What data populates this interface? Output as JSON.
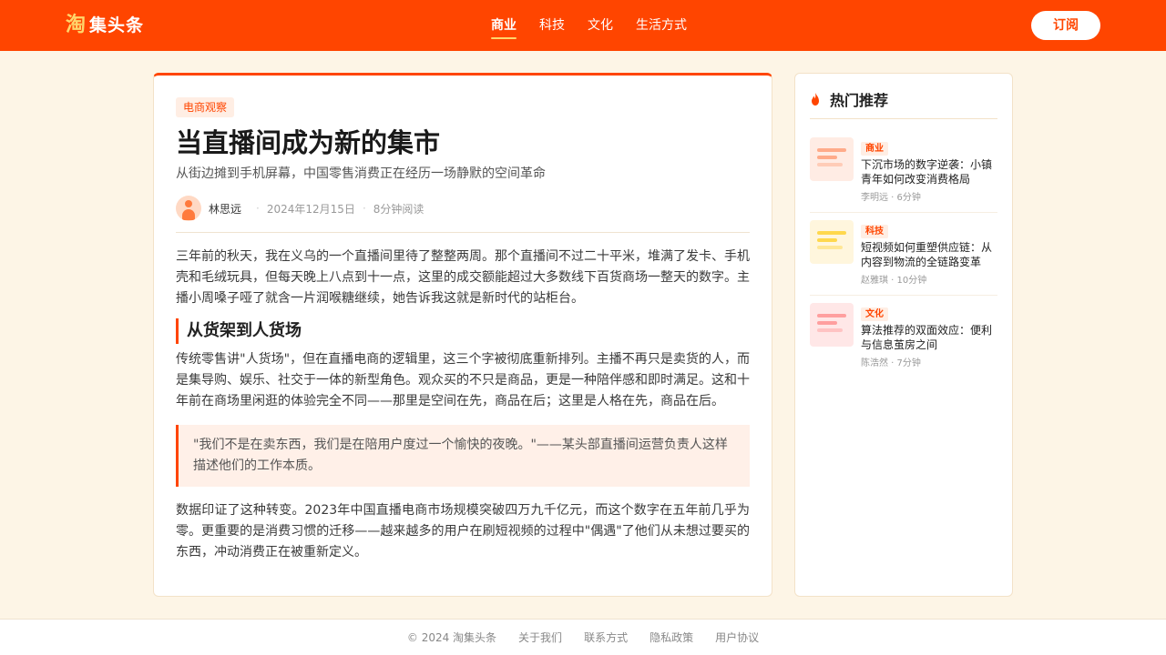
{
  "header": {
    "logo_mark": "淘",
    "logo_text": "集头条",
    "nav": [
      "商业",
      "科技",
      "文化",
      "生活方式"
    ],
    "subscribe_label": "订阅"
  },
  "article": {
    "category": "电商观察",
    "title": "当直播间成为新的集市",
    "subtitle": "从街边摊到手机屏幕，中国零售消费正在经历一场静默的空间革命",
    "author": "林思远",
    "date": "2024年12月15日",
    "read_time": "8分钟阅读",
    "paragraph1": "三年前的秋天，我在义乌的一个直播间里待了整整两周。那个直播间不过二十平米，堆满了发卡、手机壳和毛绒玩具，但每天晚上八点到十一点，这里的成交额能超过大多数线下百货商场一整天的数字。主播小周嗓子哑了就含一片润喉糖继续，她告诉我这就是新时代的站柜台。",
    "section_heading": "从货架到人货场",
    "paragraph2": "传统零售讲\"人货场\"，但在直播电商的逻辑里，这三个字被彻底重新排列。主播不再只是卖货的人，而是集导购、娱乐、社交于一体的新型角色。观众买的不只是商品，更是一种陪伴感和即时满足。这和十年前在商场里闲逛的体验完全不同——那里是空间在先，商品在后；这里是人格在先，商品在后。",
    "quote": "\"我们不是在卖东西，我们是在陪用户度过一个愉快的夜晚。\"——某头部直播间运营负责人这样描述他们的工作本质。",
    "paragraph3": "数据印证了这种转变。2023年中国直播电商市场规模突破四万九千亿元，而这个数字在五年前几乎为零。更重要的是消费习惯的迁移——越来越多的用户在刷短视频的过程中\"偶遇\"了他们从未想过要买的东西，冲动消费正在被重新定义。"
  },
  "sidebar": {
    "title": "热门推荐",
    "items": [
      {
        "tag": "商业",
        "title": "下沉市场的数字逆袭：小镇青年如何改变消费格局",
        "meta": "李明远 · 6分钟",
        "thumb_bg": "#ffece4",
        "thumb_line": "#ffab8a"
      },
      {
        "tag": "科技",
        "title": "短视频如何重塑供应链：从内容到物流的全链路变革",
        "meta": "赵雅琪 · 10分钟",
        "thumb_bg": "#fff6dd",
        "thumb_line": "#ffd84d"
      },
      {
        "tag": "文化",
        "title": "算法推荐的双面效应：便利与信息茧房之间",
        "meta": "陈浩然 · 7分钟",
        "thumb_bg": "#ffe7e7",
        "thumb_line": "#ff9f9f"
      }
    ]
  },
  "footer": {
    "copyright": "© 2024 淘集头条",
    "links": [
      "关于我们",
      "联系方式",
      "隐私政策",
      "用户协议"
    ]
  },
  "colors": {
    "brand": "#ff4500",
    "accent": "#ffd66b",
    "background": "#fdf5e6"
  }
}
